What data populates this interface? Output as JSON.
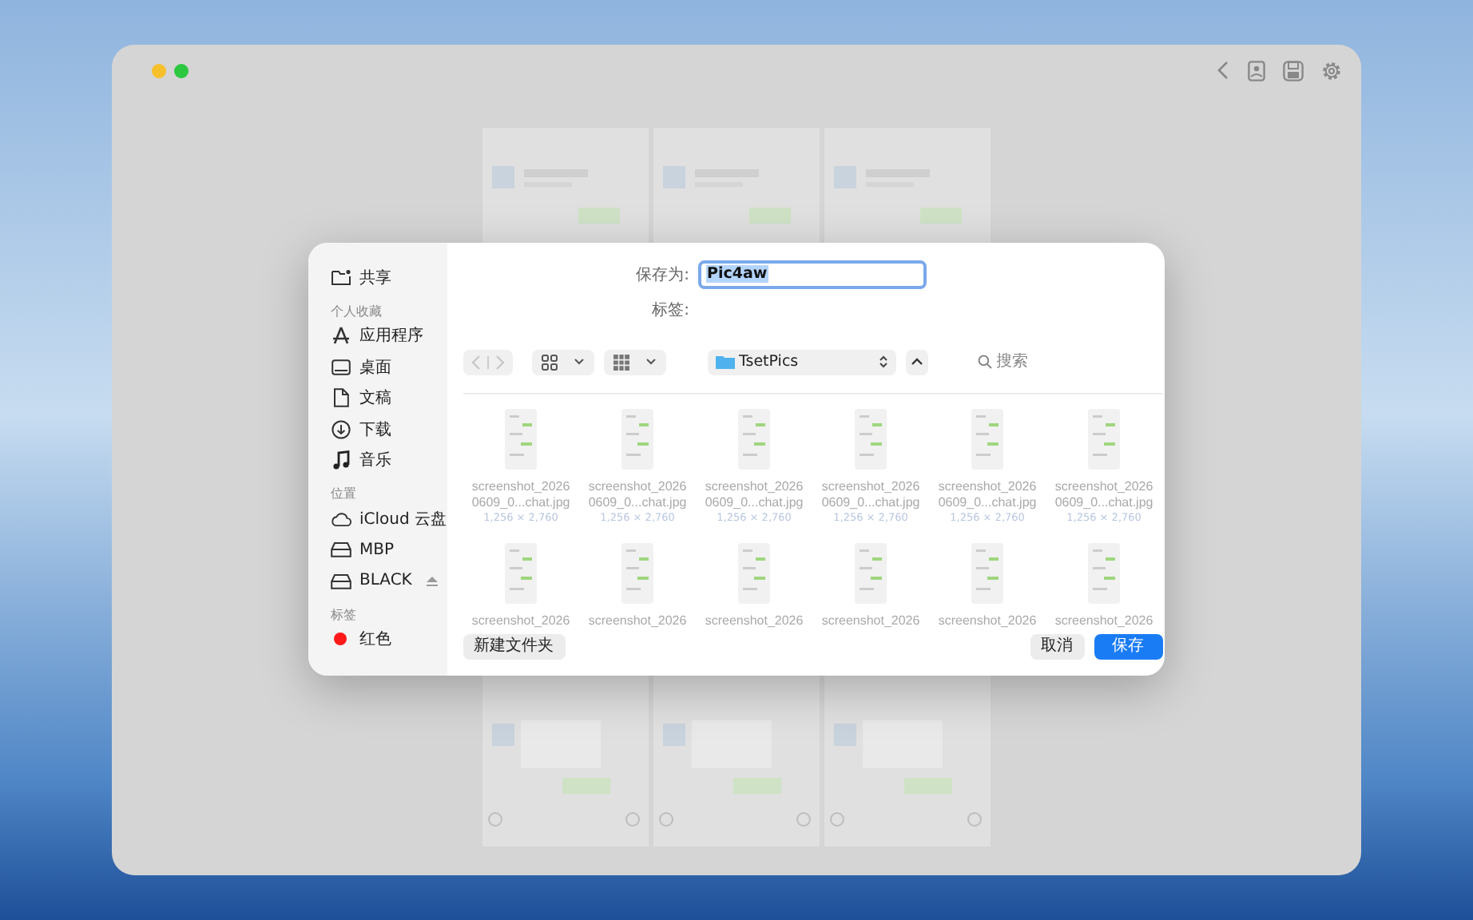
{
  "dialog": {
    "sidebar": {
      "items": [
        {
          "kind": "shared",
          "label": "共享"
        }
      ],
      "sections": [
        {
          "heading": "个人收藏",
          "items": [
            {
              "kind": "apps",
              "label": "应用程序"
            },
            {
              "kind": "desktop",
              "label": "桌面"
            },
            {
              "kind": "document",
              "label": "文稿"
            },
            {
              "kind": "download",
              "label": "下载"
            },
            {
              "kind": "music",
              "label": "音乐"
            }
          ]
        },
        {
          "heading": "位置",
          "items": [
            {
              "kind": "cloud",
              "label": "iCloud 云盘"
            },
            {
              "kind": "drive",
              "label": "MBP"
            },
            {
              "kind": "drive",
              "label": "BLACK",
              "ejectable": true
            }
          ]
        },
        {
          "heading": "标签",
          "items": [
            {
              "kind": "tag",
              "label": "红色",
              "color": "#ff1a1a"
            }
          ]
        }
      ]
    },
    "save_as": {
      "label": "保存为:",
      "value": "Pic4aw",
      "value_selected": true
    },
    "tags": {
      "label": "标签:"
    },
    "toolbar": {
      "back_disabled": true,
      "forward_disabled": true,
      "location": "TsetPics",
      "search": {
        "placeholder": "搜索"
      }
    },
    "files": [
      {
        "name_lines": [
          "screenshot_2026",
          "0609_0...chat.jpg"
        ],
        "size": "1,256 × 2,760"
      },
      {
        "name_lines": [
          "screenshot_2026",
          "0609_0...chat.jpg"
        ],
        "size": "1,256 × 2,760"
      },
      {
        "name_lines": [
          "screenshot_2026",
          "0609_0...chat.jpg"
        ],
        "size": "1,256 × 2,760"
      },
      {
        "name_lines": [
          "screenshot_2026",
          "0609_0...chat.jpg"
        ],
        "size": "1,256 × 2,760"
      },
      {
        "name_lines": [
          "screenshot_2026",
          "0609_0...chat.jpg"
        ],
        "size": "1,256 × 2,760"
      },
      {
        "name_lines": [
          "screenshot_2026",
          "0609_0...chat.jpg"
        ],
        "size": "1,256 × 2,760"
      },
      {
        "name_lines": [
          "screenshot_2026"
        ]
      },
      {
        "name_lines": [
          "screenshot_2026"
        ]
      },
      {
        "name_lines": [
          "screenshot_2026"
        ]
      },
      {
        "name_lines": [
          "screenshot_2026"
        ]
      },
      {
        "name_lines": [
          "screenshot_2026"
        ]
      },
      {
        "name_lines": [
          "screenshot_2026"
        ]
      }
    ],
    "buttons": {
      "new_folder": "新建文件夹",
      "cancel": "取消",
      "save": "保存"
    }
  }
}
